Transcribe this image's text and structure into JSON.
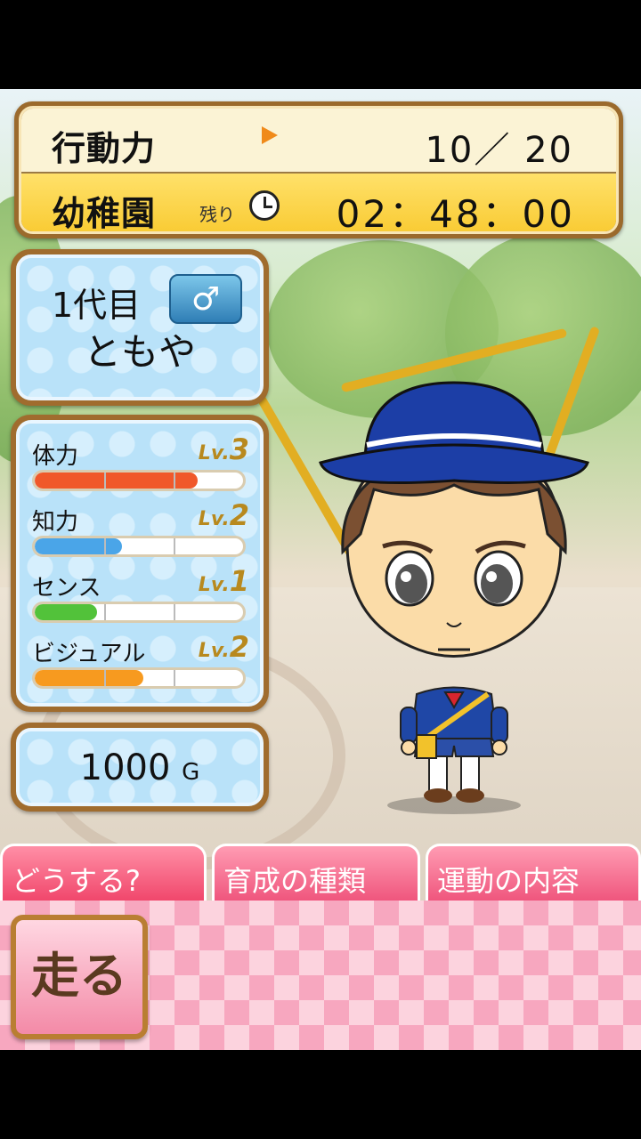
{
  "status": {
    "action_label": "行動力",
    "action_value": "10／ 20",
    "stage_label": "幼稚園",
    "remaining_label": "残り",
    "timer": "02：48：00"
  },
  "profile": {
    "generation": "1代目",
    "gender_symbol": "♂",
    "name": "ともや"
  },
  "stats": [
    {
      "name": "体力",
      "lv_prefix": "Lv.",
      "level": "3",
      "fill": 0.78,
      "color": "#f0582a"
    },
    {
      "name": "知力",
      "lv_prefix": "Lv.",
      "level": "2",
      "fill": 0.42,
      "color": "#4aa5e8"
    },
    {
      "name": "センス",
      "lv_prefix": "Lv.",
      "level": "1",
      "fill": 0.3,
      "color": "#52c23a"
    },
    {
      "name": "ビジュアル",
      "lv_prefix": "Lv.",
      "level": "2",
      "fill": 0.52,
      "color": "#f79a1f"
    }
  ],
  "money": {
    "amount": "1000",
    "unit": "G"
  },
  "tabs": [
    "どうする?",
    "育成の種類",
    "運動の内容"
  ],
  "action_button": "走る",
  "icons": {
    "clock": "clock-icon",
    "male": "male-icon",
    "arrow": "play-arrow-icon"
  }
}
